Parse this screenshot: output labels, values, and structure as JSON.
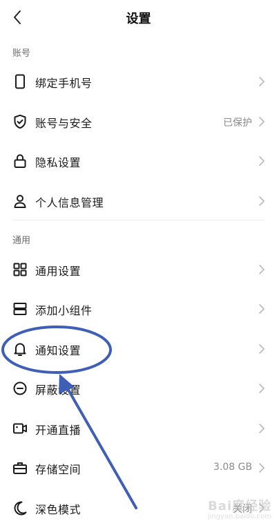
{
  "nav": {
    "title": "设置"
  },
  "sections": {
    "account": {
      "title": "账号"
    },
    "general": {
      "title": "通用"
    }
  },
  "items": [
    {
      "label": "绑定手机号",
      "value": "",
      "icon": "phone-icon"
    },
    {
      "label": "账号与安全",
      "value": "已保护",
      "icon": "shield-check-icon"
    },
    {
      "label": "隐私设置",
      "value": "",
      "icon": "lock-icon"
    },
    {
      "label": "个人信息管理",
      "value": "",
      "icon": "user-icon"
    },
    {
      "label": "通用设置",
      "value": "",
      "icon": "grid-icon"
    },
    {
      "label": "添加小组件",
      "value": "",
      "icon": "widget-icon"
    },
    {
      "label": "通知设置",
      "value": "",
      "icon": "bell-icon"
    },
    {
      "label": "屏蔽设置",
      "value": "",
      "icon": "block-icon"
    },
    {
      "label": "开通直播",
      "value": "",
      "icon": "video-camera-icon"
    },
    {
      "label": "存储空间",
      "value": "3.08 GB",
      "icon": "storage-box-icon"
    },
    {
      "label": "深色模式",
      "value": "关闭",
      "icon": "moon-icon"
    }
  ],
  "watermark": {
    "brand": "Bai度经验",
    "domain": "jingyan.baidu.com"
  },
  "colors": {
    "annotation": "#3f5fb7",
    "text": "#1a1a1a",
    "secondary": "#8a8a8a",
    "chevron": "#b8b8b8"
  }
}
